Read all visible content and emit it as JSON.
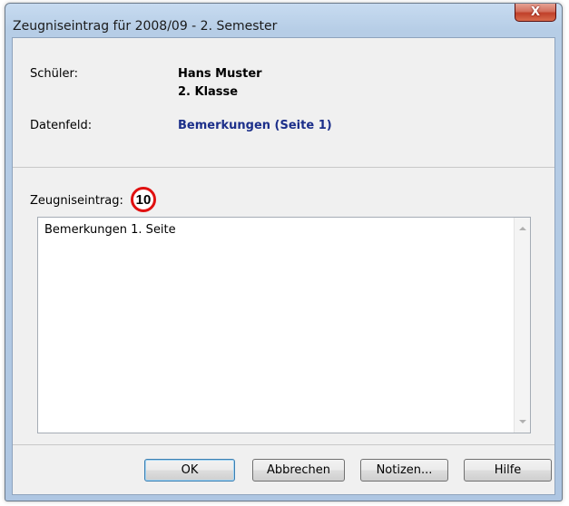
{
  "window": {
    "title": "Zeugniseintrag für 2008/09 - 2. Semester",
    "close_label": "X"
  },
  "info": {
    "student_label": "Schüler:",
    "student_name": "Hans Muster",
    "student_class": "2. Klasse",
    "field_label": "Datenfeld:",
    "field_value": "Bemerkungen (Seite 1)"
  },
  "entry": {
    "label": "Zeugniseintrag:",
    "callout_number": "10",
    "text": "Bemerkungen 1. Seite"
  },
  "buttons": {
    "ok": "OK",
    "cancel": "Abbrechen",
    "notes": "Notizen...",
    "help": "Hilfe"
  },
  "colors": {
    "field_value": "#1c2f8a",
    "callout_ring": "#e01010",
    "close_button": "#c0402a"
  }
}
